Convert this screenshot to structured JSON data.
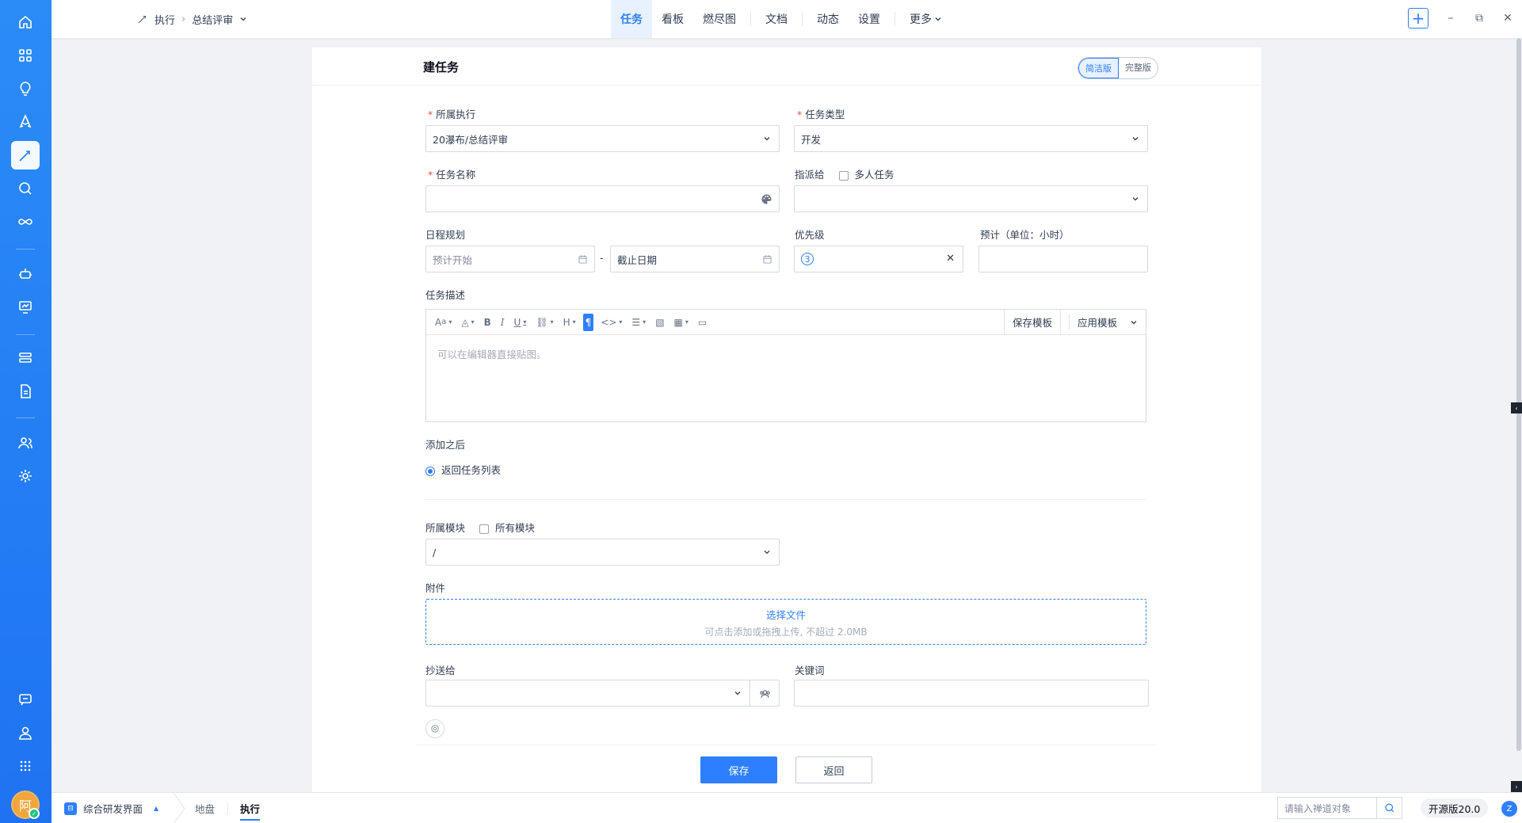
{
  "sidebar": {
    "icons": [
      "home-icon",
      "grid-icon",
      "lightbulb-icon",
      "rocket-icon",
      "execution-icon",
      "search-icon",
      "infinity-icon",
      "robot-icon",
      "presentation-icon",
      "server-icon",
      "document-icon",
      "users-icon",
      "settings-icon",
      "chat-icon",
      "user-icon",
      "apps-icon"
    ],
    "active": "execution-icon",
    "avatar_text": "阿"
  },
  "breadcrumb": {
    "execution": "执行",
    "current": "总结评审"
  },
  "nav": {
    "tabs": [
      "任务",
      "看板",
      "燃尽图",
      "文档",
      "动态",
      "设置",
      "更多"
    ],
    "active": "任务"
  },
  "panel": {
    "title": "建任务",
    "version_simple": "简洁版",
    "version_full": "完整版"
  },
  "form": {
    "execution_label": "所属执行",
    "execution_value": "20瀑布/总结评审",
    "type_label": "任务类型",
    "type_value": "开发",
    "name_label": "任务名称",
    "name_value": "",
    "assign_label": "指派给",
    "multi_label": "多人任务",
    "assign_value": "",
    "schedule_label": "日程规划",
    "start_placeholder": "预计开始",
    "date_sep": "-",
    "end_placeholder": "截止日期",
    "priority_label": "优先级",
    "priority_value": "3",
    "estimate_label": "预计（单位：小时）",
    "estimate_value": "",
    "desc_label": "任务描述",
    "desc_placeholder": "可以在编辑器直接贴图。",
    "save_template": "保存模板",
    "apply_template": "应用模板",
    "after_label": "添加之后",
    "after_option": "返回任务列表",
    "module_label": "所属模块",
    "all_modules_label": "所有模块",
    "module_value": "/",
    "attach_label": "附件",
    "attach_select": "选择文件",
    "attach_hint": "可点击添加或拖拽上传, 不超过 2.0MB",
    "cc_label": "抄送给",
    "cc_value": "",
    "keywords_label": "关键词",
    "keywords_value": ""
  },
  "actions": {
    "save": "保存",
    "back": "返回"
  },
  "bottombar": {
    "app": "综合研发界面",
    "links": [
      "地盘",
      "执行"
    ],
    "active": "执行",
    "search_placeholder": "请输入禅道对象",
    "version": "开源版20.0"
  },
  "colors": {
    "primary": "#2e7fff",
    "sidebar": "#1f73f2",
    "required": "#e84e4e"
  }
}
